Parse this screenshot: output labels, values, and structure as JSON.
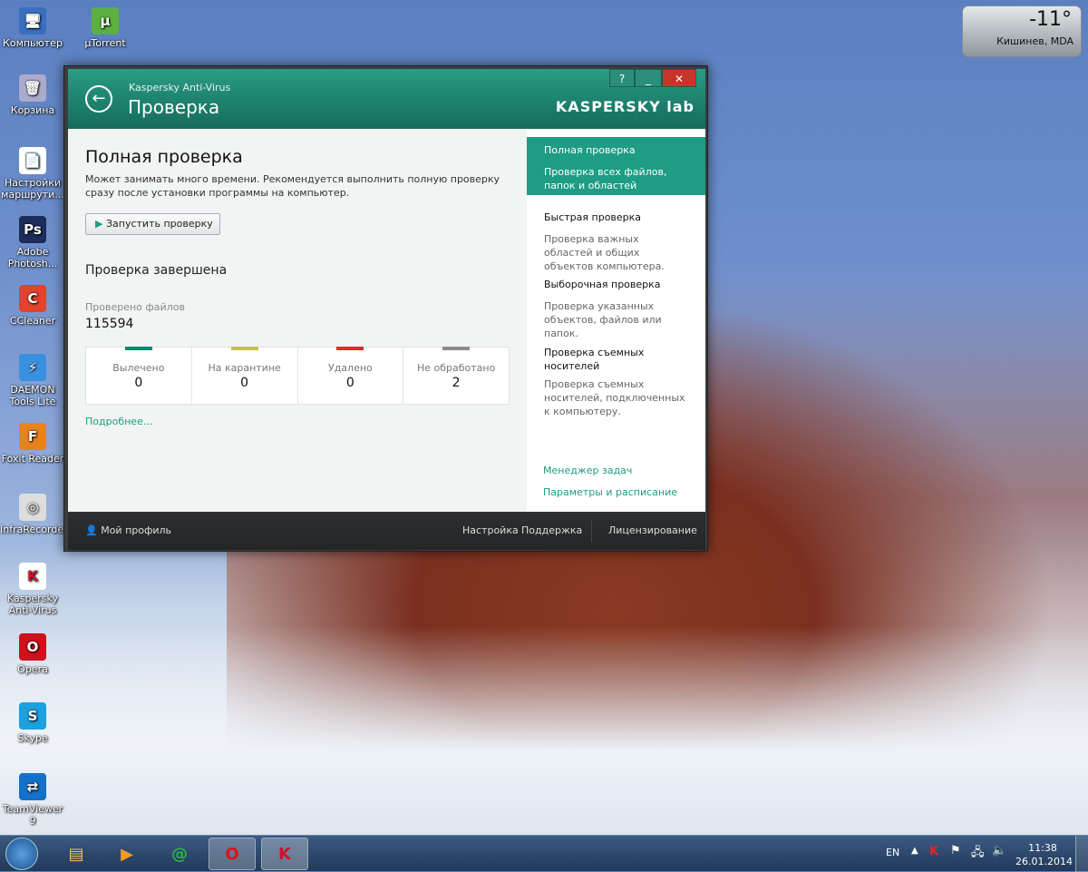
{
  "desktop": {
    "icons": [
      "Компьютер",
      "µTorrent",
      "Корзина",
      "Настройки маршрути...",
      "Adobe Photosh...",
      "CCleaner",
      "DAEMON Tools Lite",
      "Foxit Reader",
      "InfraRecorder",
      "Kaspersky Anti-Virus",
      "Opera",
      "Skype",
      "TeamViewer 9"
    ]
  },
  "weather": {
    "temp": "-11°",
    "city": "Кишинев, MDA"
  },
  "window": {
    "app_name": "Kaspersky Anti-Virus",
    "title": "Проверка",
    "logo": "KASPERSKY lab",
    "help": "?",
    "minimize": "_",
    "close": "✕",
    "main": {
      "heading": "Полная проверка",
      "description": "Может занимать много времени. Рекомендуется выполнить полную проверку сразу после установки программы на компьютер.",
      "start_button": "Запустить проверку",
      "status": "Проверка завершена",
      "files_label": "Проверено файлов",
      "files_value": "115594",
      "stats": [
        {
          "label": "Вылечено",
          "value": "0",
          "color": "#0e8a6e"
        },
        {
          "label": "На карантине",
          "value": "0",
          "color": "#c8c23a"
        },
        {
          "label": "Удалено",
          "value": "0",
          "color": "#e8262b"
        },
        {
          "label": "Не обработано",
          "value": "2",
          "color": "#8c8c8c"
        }
      ],
      "more_link": "Подробнее..."
    },
    "scan_types": [
      {
        "title": "Полная проверка",
        "desc": "Проверка всех файлов, папок и областей компьютера."
      },
      {
        "title": "Быстрая проверка",
        "desc": "Проверка важных областей и общих объектов компьютера."
      },
      {
        "title": "Выборочная проверка",
        "desc": "Проверка указанных объектов, файлов или папок."
      },
      {
        "title": "Проверка съемных носителей",
        "desc": "Проверка съемных носителей, подключенных к компьютеру."
      }
    ],
    "links": {
      "task_manager": "Менеджер задач",
      "schedule": "Параметры и расписание"
    },
    "footer": {
      "profile": "Мой профиль",
      "settings": "Настройка",
      "support": "Поддержка",
      "licensing": "Лицензирование"
    }
  },
  "taskbar": {
    "lang": "EN",
    "time": "11:38",
    "date": "26.01.2014"
  }
}
